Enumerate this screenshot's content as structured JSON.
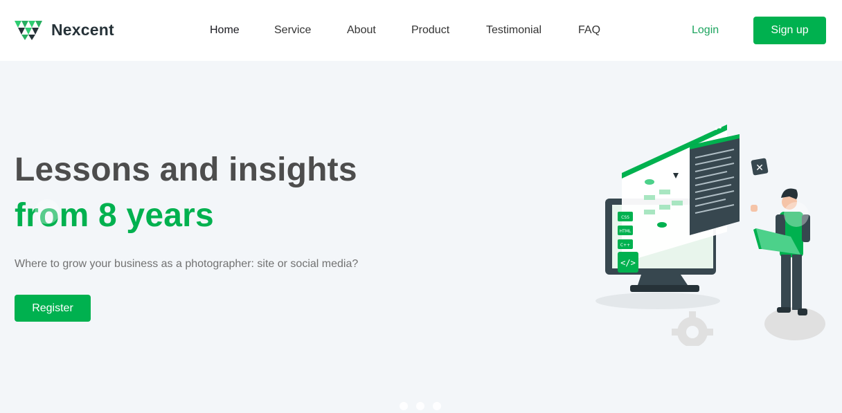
{
  "brand": {
    "name": "Nexcent",
    "logo_icon": "nexcent-logo-icon",
    "accent": "#00B14F"
  },
  "nav": {
    "items": [
      {
        "label": "Home",
        "active": true
      },
      {
        "label": "Service"
      },
      {
        "label": "About"
      },
      {
        "label": "Product"
      },
      {
        "label": "Testimonial"
      },
      {
        "label": "FAQ"
      }
    ],
    "login": "Login",
    "signup": "Sign up"
  },
  "hero": {
    "title_line1": "Lessons and insights",
    "title_line2": "from 8 years",
    "subtitle": "Where to grow your business as a photographer: site or social media?",
    "cta": "Register",
    "slides": 3,
    "active_slide": 3
  },
  "illustration": {
    "icon": "developer-desk-illustration",
    "code_tags": [
      "CSS",
      "HTML",
      "C++"
    ]
  }
}
